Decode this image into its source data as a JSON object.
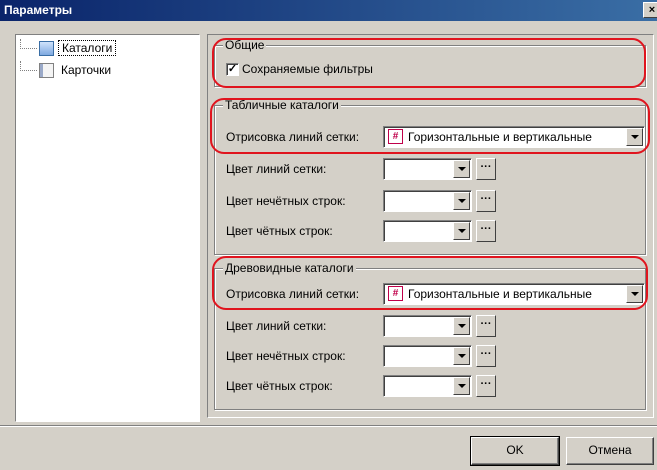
{
  "window": {
    "title": "Параметры",
    "close_label": "×"
  },
  "tree": {
    "items": [
      {
        "label": "Каталоги",
        "icon": "catalog-icon",
        "selected": true
      },
      {
        "label": "Карточки",
        "icon": "card-icon",
        "selected": false
      }
    ]
  },
  "general": {
    "title": "Общие",
    "saved_filters_label": "Сохраняемые фильтры",
    "saved_filters_checked": true,
    "check_mark": "✓"
  },
  "table_catalogs": {
    "title": "Табличные каталоги",
    "grid_lines_label": "Отрисовка линий сетки:",
    "grid_lines_value": "Горизонтальные и вертикальные",
    "grid_color_label": "Цвет линий сетки:",
    "odd_rows_label": "Цвет нечётных строк:",
    "even_rows_label": "Цвет чётных строк:"
  },
  "tree_catalogs": {
    "title": "Древовидные каталоги",
    "grid_lines_label": "Отрисовка линий сетки:",
    "grid_lines_value": "Горизонтальные и вертикальные",
    "grid_color_label": "Цвет линий сетки:",
    "odd_rows_label": "Цвет нечётных строк:",
    "even_rows_label": "Цвет чётных строк:"
  },
  "buttons": {
    "ok": "OK",
    "cancel": "Отмена"
  },
  "ui": {
    "dots": "···",
    "grid_glyph": "#"
  },
  "colors": {
    "highlight": "#e0141e",
    "titlebar": "#0a246a"
  }
}
